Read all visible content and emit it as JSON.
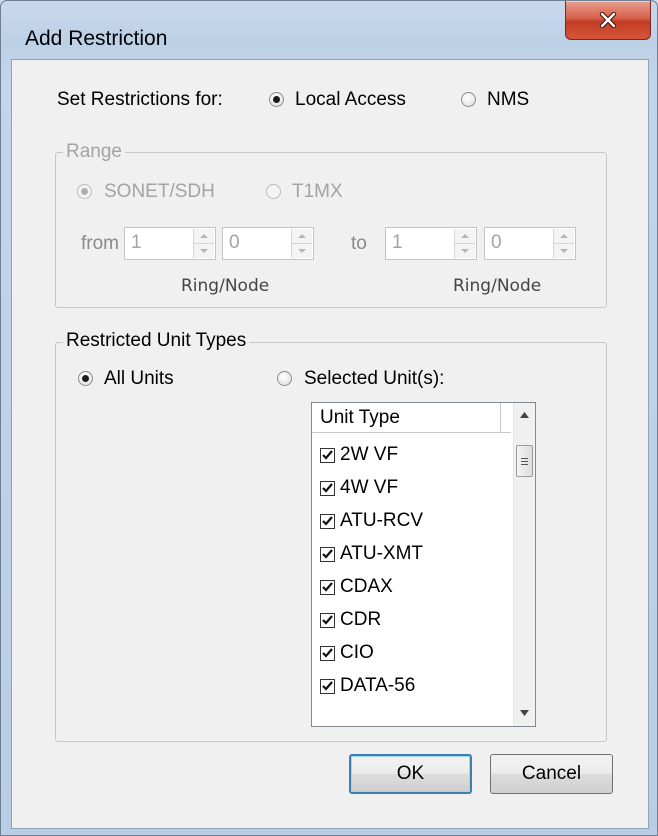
{
  "window": {
    "title": "Add Restriction"
  },
  "set_restrictions": {
    "label": "Set Restrictions for:",
    "options": [
      "Local Access",
      "NMS"
    ],
    "selected": "Local Access"
  },
  "range": {
    "legend": "Range",
    "options": [
      "SONET/SDH",
      "T1MX"
    ],
    "selected": "SONET/SDH",
    "from_label": "from",
    "to_label": "to",
    "from_ring": "1",
    "from_node": "0",
    "to_ring": "1",
    "to_node": "0",
    "ring_node_caption": "Ring/Node"
  },
  "restricted_units": {
    "legend": "Restricted Unit Types",
    "options": [
      "All Units",
      "Selected Unit(s):"
    ],
    "selected": "All Units",
    "list_header": "Unit Type",
    "items": [
      {
        "label": "2W VF",
        "checked": true
      },
      {
        "label": "4W VF",
        "checked": true
      },
      {
        "label": "ATU-RCV",
        "checked": true
      },
      {
        "label": "ATU-XMT",
        "checked": true
      },
      {
        "label": "CDAX",
        "checked": true
      },
      {
        "label": "CDR",
        "checked": true
      },
      {
        "label": "CIO",
        "checked": true
      },
      {
        "label": "DATA-56",
        "checked": true
      }
    ]
  },
  "buttons": {
    "ok": "OK",
    "cancel": "Cancel"
  },
  "icons": {
    "close": "close-icon",
    "scroll_up": "chevron-up-icon",
    "scroll_down": "chevron-down-icon"
  }
}
